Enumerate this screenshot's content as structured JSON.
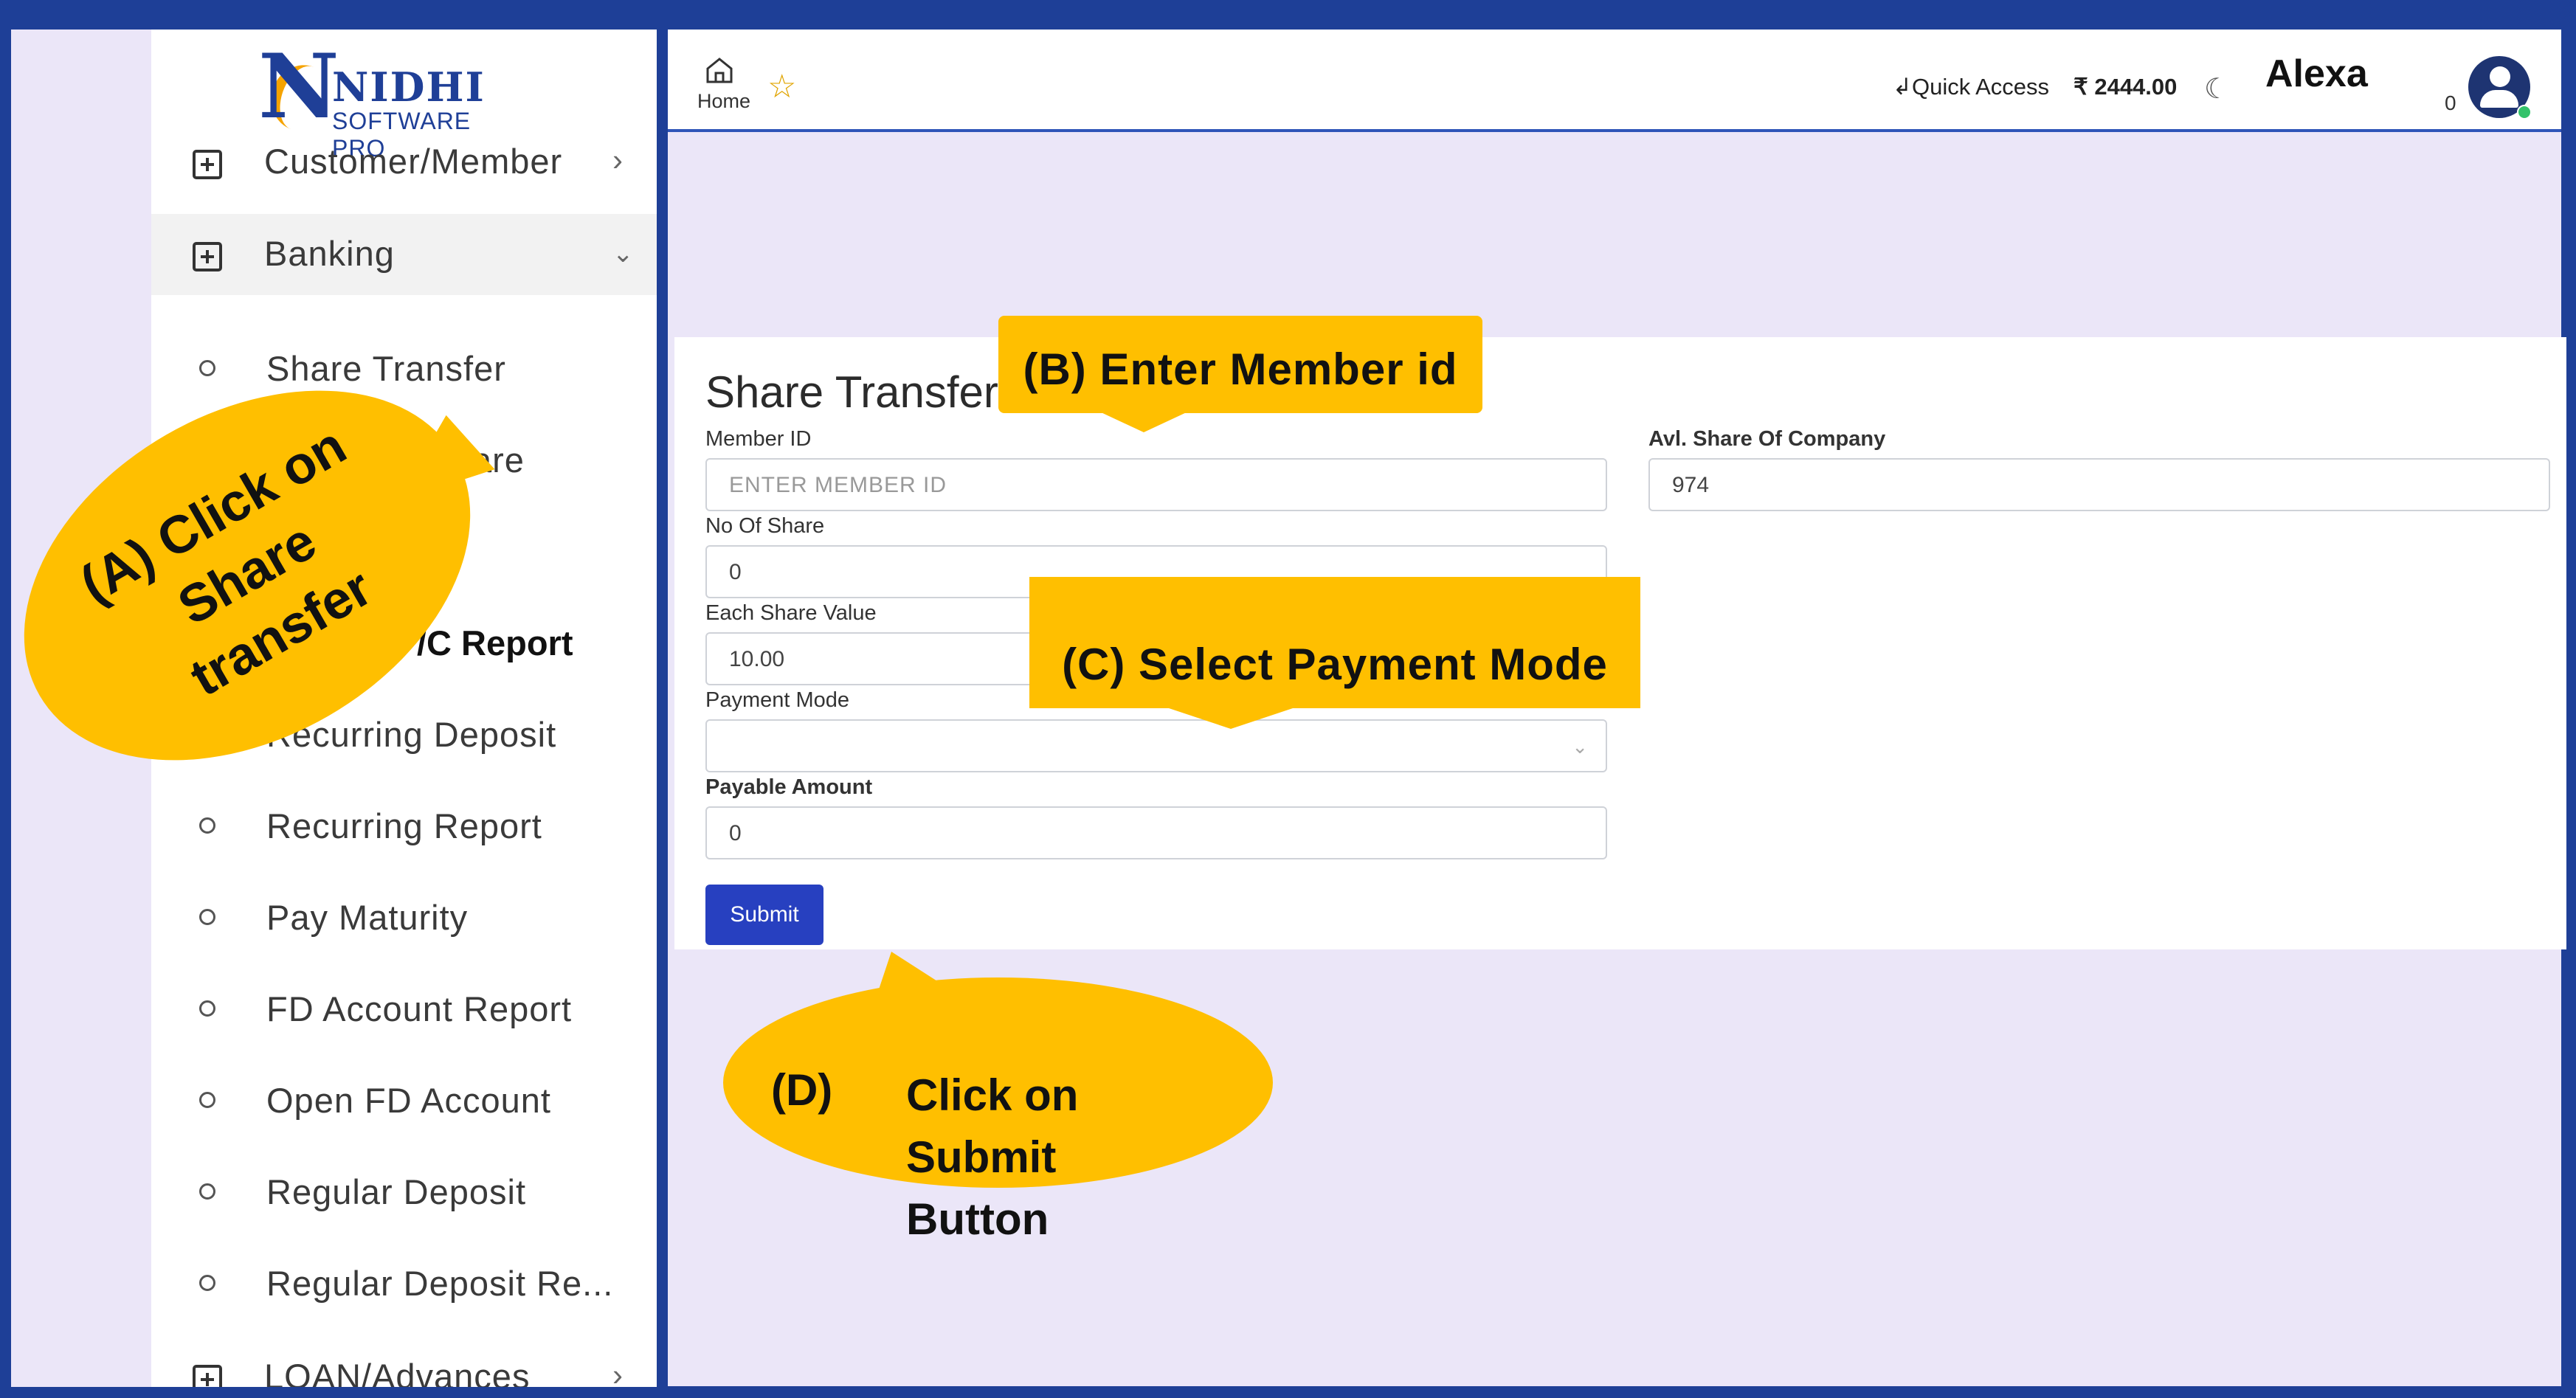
{
  "sidebar": {
    "brand_mark": "N",
    "brand_name": "NIDHI",
    "brand_sub": "SOFTWARE PRO",
    "menu": [
      {
        "label": "Customer/Member",
        "icon": "plus-square-icon",
        "chevron": "chevron-right-icon"
      },
      {
        "label": "Banking",
        "icon": "plus-square-icon",
        "chevron": "chevron-down-icon"
      }
    ],
    "sub_items": [
      "Share Transfer",
      "are",
      "",
      "/C Report",
      "Recurring Deposit",
      "Recurring Report",
      "Pay Maturity",
      "FD Account Report",
      "Open FD Account",
      "Regular Deposit",
      "Regular Deposit Re..."
    ],
    "bottom_menu": {
      "label": "LOAN/Advances",
      "icon": "plus-square-icon",
      "chevron": "chevron-right-icon"
    }
  },
  "topbar": {
    "home_label": "Home",
    "quick_access": "Quick Access",
    "balance": "₹ 2444.00",
    "user_name": "Alexa",
    "notification_count": "0"
  },
  "form": {
    "title": "Share Transfer",
    "member_id_label": "Member ID",
    "member_id_placeholder": "ENTER MEMBER ID",
    "avl_share_label": "Avl. Share Of Company",
    "avl_share_value": "974",
    "no_of_share_label": "No Of Share",
    "no_of_share_value": "0",
    "each_share_value_label": "Each Share Value",
    "each_share_value": "10.00",
    "payment_mode_label": "Payment Mode",
    "payment_mode_value": "",
    "payable_amount_label": "Payable Amount",
    "payable_amount_value": "0",
    "submit_label": "Submit"
  },
  "callouts": {
    "a_line1": "(A) Click on",
    "a_line2": "Share transfer",
    "b": "(B) Enter Member id",
    "c": "(C) Select Payment Mode",
    "d_letter": "(D)",
    "d_text": "Click on\nSubmit\nButton"
  },
  "colors": {
    "frame_blue": "#1e3f97",
    "callout_yellow": "#ffbf00",
    "button_blue": "#2740c0",
    "content_bg": "#ebe6f8"
  }
}
